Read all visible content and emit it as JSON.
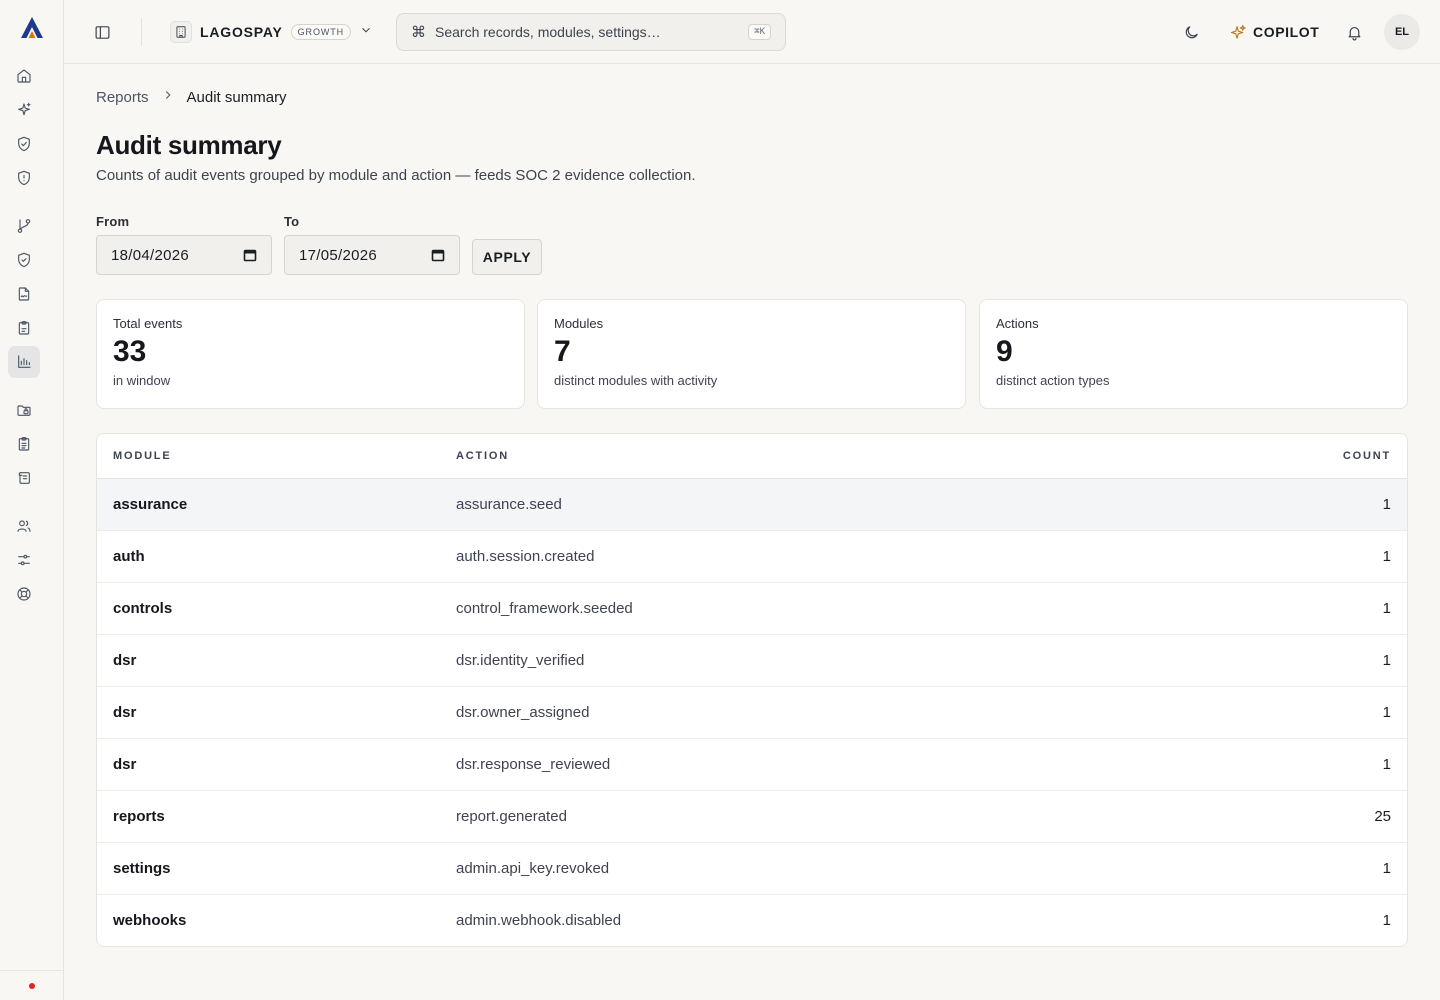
{
  "topbar": {
    "tenant_name": "LAGOSPAY",
    "plan_badge": "GROWTH",
    "search_placeholder": "Search records, modules, settings…",
    "search_shortcut": "⌘K",
    "copilot_label": "COPILOT",
    "avatar_initials": "EL"
  },
  "rail": {
    "icons": [
      "home-icon",
      "sparkles-icon",
      "shield-check-icon",
      "shield-alert-icon",
      "git-branch-icon",
      "shield-icon",
      "file-signature-icon",
      "clipboard-icon",
      "bar-chart-icon",
      "folder-lock-icon",
      "clipboard-list-icon",
      "scroll-icon",
      "users-icon",
      "sliders-icon",
      "life-buoy-icon"
    ],
    "active": "bar-chart-icon",
    "status_color": "#dc2626"
  },
  "breadcrumb": {
    "parent": "Reports",
    "current": "Audit summary"
  },
  "page": {
    "title": "Audit summary",
    "description": "Counts of audit events grouped by module and action — feeds SOC 2 evidence collection."
  },
  "filters": {
    "from_label": "From",
    "from_value": "18/04/2026",
    "to_label": "To",
    "to_value": "17/05/2026",
    "apply_label": "APPLY"
  },
  "stats": [
    {
      "label": "Total events",
      "value": "33",
      "sub": "in window"
    },
    {
      "label": "Modules",
      "value": "7",
      "sub": "distinct modules with activity"
    },
    {
      "label": "Actions",
      "value": "9",
      "sub": "distinct action types"
    }
  ],
  "table": {
    "headers": {
      "module": "MODULE",
      "action": "ACTION",
      "count": "COUNT"
    },
    "rows": [
      {
        "module": "assurance",
        "action": "assurance.seed",
        "count": "1"
      },
      {
        "module": "auth",
        "action": "auth.session.created",
        "count": "1"
      },
      {
        "module": "controls",
        "action": "control_framework.seeded",
        "count": "1"
      },
      {
        "module": "dsr",
        "action": "dsr.identity_verified",
        "count": "1"
      },
      {
        "module": "dsr",
        "action": "dsr.owner_assigned",
        "count": "1"
      },
      {
        "module": "dsr",
        "action": "dsr.response_reviewed",
        "count": "1"
      },
      {
        "module": "reports",
        "action": "report.generated",
        "count": "25"
      },
      {
        "module": "settings",
        "action": "admin.api_key.revoked",
        "count": "1"
      },
      {
        "module": "webhooks",
        "action": "admin.webhook.disabled",
        "count": "1"
      }
    ]
  },
  "colors": {
    "accent_blue": "#1e3a8a",
    "accent_gold": "#d97706",
    "copilot": "#b7791f"
  }
}
